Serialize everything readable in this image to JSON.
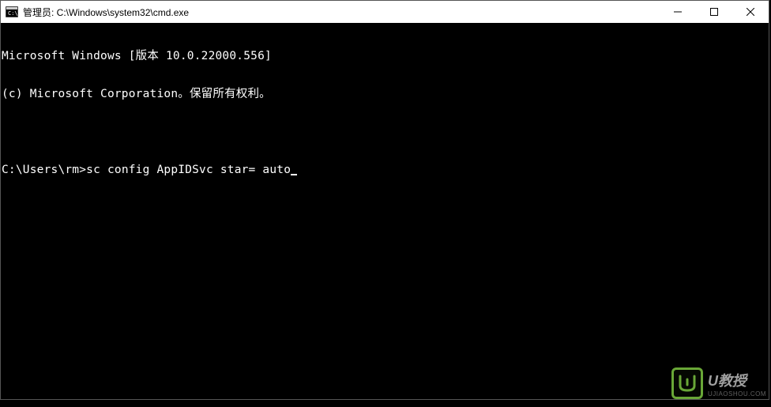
{
  "window": {
    "title": "管理员: C:\\Windows\\system32\\cmd.exe"
  },
  "terminal": {
    "line1": "Microsoft Windows [版本 10.0.22000.556]",
    "line2": "(c) Microsoft Corporation。保留所有权利。",
    "blank": "",
    "prompt": "C:\\Users\\rm>",
    "command": "sc config AppIDSvc star= auto"
  },
  "watermark": {
    "brand": "U教授",
    "sub": "UJIAOSHOU.COM"
  }
}
